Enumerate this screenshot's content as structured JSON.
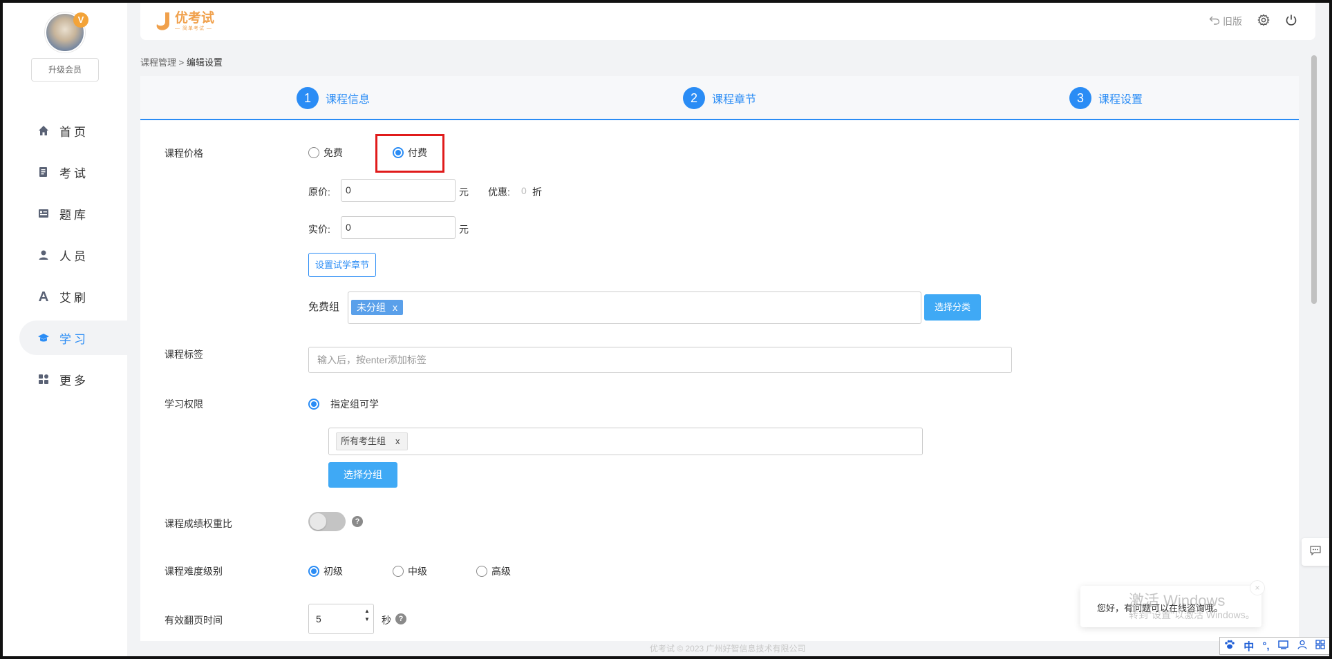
{
  "sidebar": {
    "upgrade_label": "升级会员",
    "items": [
      {
        "label": "首页",
        "icon": "home-icon"
      },
      {
        "label": "考试",
        "icon": "exam-icon"
      },
      {
        "label": "题库",
        "icon": "question-bank-icon"
      },
      {
        "label": "人员",
        "icon": "person-icon"
      },
      {
        "label": "艾刷",
        "icon": "font-a-icon"
      },
      {
        "label": "学习",
        "icon": "graduation-cap-icon"
      },
      {
        "label": "更多",
        "icon": "grid-icon"
      }
    ],
    "active_index": 5
  },
  "header": {
    "logo_text": "优考试",
    "logo_sub": "— 简单考试 —",
    "old_version_label": "旧版"
  },
  "breadcrumb": {
    "parent": "课程管理",
    "separator": ">",
    "current": "编辑设置"
  },
  "steps": [
    {
      "num": "1",
      "label": "课程信息"
    },
    {
      "num": "2",
      "label": "课程章节"
    },
    {
      "num": "3",
      "label": "课程设置"
    }
  ],
  "form": {
    "price": {
      "label": "课程价格",
      "option_free": "免费",
      "option_paid": "付费",
      "selected": "付费",
      "original_label": "原价:",
      "original_value": "0",
      "currency": "元",
      "discount_label": "优惠:",
      "discount_value": "0",
      "discount_unit": "折",
      "actual_label": "实价:",
      "actual_value": "0",
      "trial_button": "设置试学章节",
      "free_group_label": "免费组",
      "free_group_tag": "未分组",
      "tag_remove": "x",
      "choose_category_button": "选择分类"
    },
    "tags": {
      "label": "课程标签",
      "placeholder": "输入后，按enter添加标签"
    },
    "permission": {
      "label": "学习权限",
      "option": "指定组可学",
      "group_tag": "所有考生组",
      "tag_remove": "x",
      "choose_group_button": "选择分组"
    },
    "weight": {
      "label": "课程成绩权重比",
      "enabled": false
    },
    "difficulty": {
      "label": "课程难度级别",
      "options": [
        "初级",
        "中级",
        "高级"
      ],
      "selected": "初级"
    },
    "page_time": {
      "label": "有效翻页时间",
      "value": "5",
      "unit": "秒"
    }
  },
  "footer": {
    "copyright": "优考试 © 2023 广州好智信息技术有限公司"
  },
  "chat": {
    "message": "您好，有问题可以在线咨询哦。",
    "close": "×"
  },
  "watermark": {
    "line1": "激活 Windows",
    "line2": "转到\"设置\"以激活 Windows。"
  },
  "ime": {
    "mode": "中",
    "punct": "°,"
  },
  "colors": {
    "accent": "#2a8cf5",
    "button_blue": "#3fa9f5",
    "logo_orange": "#f0a04b",
    "highlight_red": "#e01b1b"
  }
}
